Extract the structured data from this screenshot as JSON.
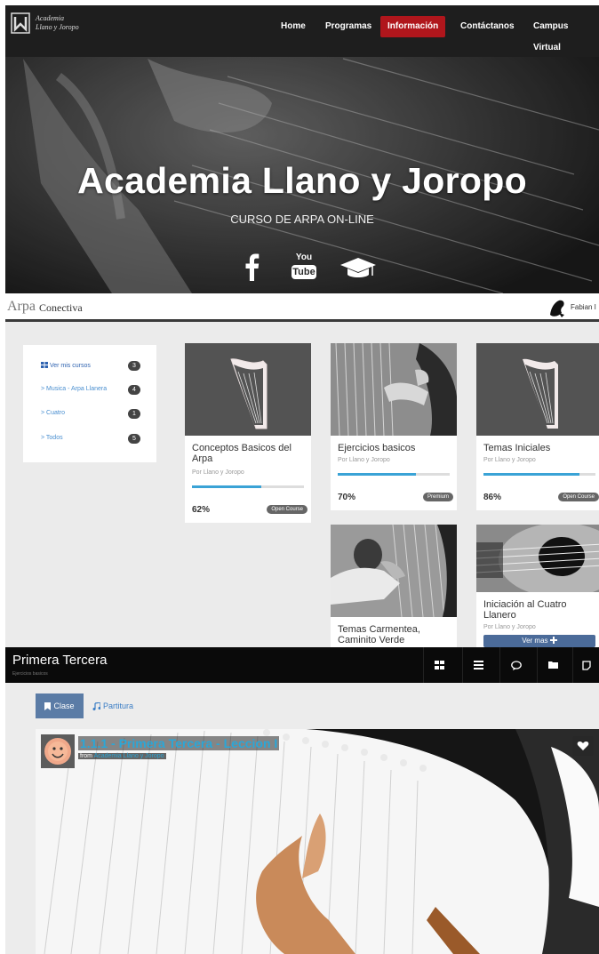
{
  "hero": {
    "logo_line1": "Academia",
    "logo_line2": "Llano y Joropo",
    "nav": [
      "Home",
      "Programas",
      "Información",
      "Contáctanos",
      "Campus Virtual"
    ],
    "active_nav": "Información",
    "title": "Academia Llano y Joropo",
    "subtitle": "CURSO DE ARPA ON-LINE",
    "social_icons": [
      "facebook-icon",
      "youtube-icon",
      "graduation-cap-icon"
    ],
    "youtube_you": "You",
    "youtube_tube": "Tube",
    "accent_color": "#b0161c"
  },
  "arpa_conectiva": {
    "brand_main": "Arpa",
    "brand_rest": "Conectiva",
    "user_name": "Fabian I",
    "filters": [
      {
        "label": "Ver mis cursos",
        "count": "3"
      },
      {
        "label": "> Musica - Arpa Llanera",
        "count": "4"
      },
      {
        "label": "> Cuatro",
        "count": "1"
      },
      {
        "label": "> Todos",
        "count": "5"
      }
    ],
    "courses": [
      {
        "title": "Conceptos Basicos del Arpa",
        "author": "Por Llano y Joropo",
        "progress": 62,
        "pct": "62%",
        "badge": "Open Course"
      },
      {
        "title": "Ejercicios basicos",
        "author": "Por Llano y Joropo",
        "progress": 70,
        "pct": "70%",
        "badge": "Premium"
      },
      {
        "title": "Temas Iniciales",
        "author": "Por Llano y Joropo",
        "progress": 86,
        "pct": "86%",
        "badge": "Open Course"
      },
      {
        "title": "Temas Carmentea, Caminito Verde",
        "author": ""
      },
      {
        "title": "Iniciación al Cuatro Llanero",
        "author": "Por Llano y Joropo",
        "button": "Ver mas"
      }
    ],
    "accent_color": "#3aa3d6"
  },
  "lesson": {
    "title": "Primera Tercera",
    "subtitle": "Ejercicios basicos",
    "toolbar_icons": [
      "grid-icon",
      "list-icon",
      "chat-icon",
      "folder-icon",
      "note-icon"
    ],
    "tabs": [
      "Clase",
      "Partitura"
    ],
    "video_title": "1.1.1 - Primera Tercera - Leccion I",
    "video_from_prefix": "from",
    "video_from": "Academia Llano y Joropo"
  }
}
